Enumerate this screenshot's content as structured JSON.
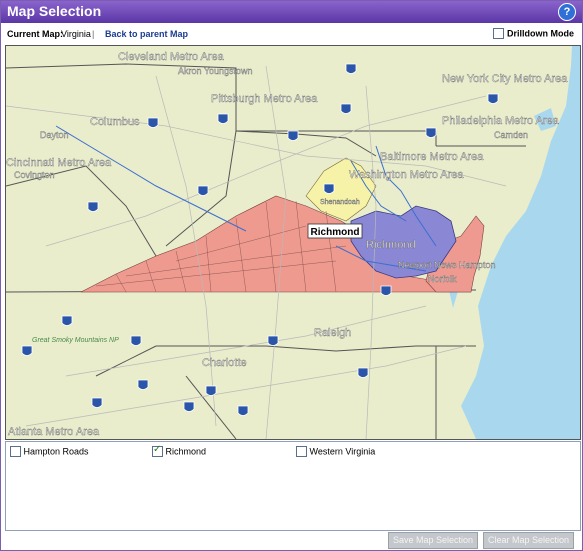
{
  "window": {
    "title": "Map Selection",
    "help_symbol": "?"
  },
  "toolbar": {
    "current_map_label": "Current Map:",
    "current_map_value": "Virginia",
    "separator": "|",
    "back_link": "Back to parent Map",
    "drilldown_label": "Drilldown Mode",
    "drilldown_checked": false
  },
  "map": {
    "selected_label": "Richmond",
    "place_labels": {
      "cleveland": "Cleveland Metro Area",
      "akron": "Akron Youngstown",
      "pittsburgh": "Pittsburgh Metro Area",
      "nyc": "New York City Metro Area",
      "philly": "Philadelphia Metro Area",
      "camden": "Camden",
      "columbus": "Columbus",
      "dayton": "Dayton",
      "cincinnati": "Cincinnati Metro Area",
      "covington": "Covington",
      "baltimore": "Baltimore Metro Area",
      "washington": "Washington Metro Area",
      "shenandoah": "Shenandoah",
      "richmond_overlay": "Richmond",
      "hampton": "Newport News Hampton",
      "norfolk": "Norfolk",
      "raleigh": "Raleigh",
      "smoky": "Great Smoky Mountains NP",
      "charlotte": "Charlotte",
      "atlanta": "Atlanta Metro Area"
    },
    "colors": {
      "water": "#a9d8ee",
      "land": "#e9edcc",
      "selected": "#8a87d4",
      "other_region": "#ef9a8f",
      "hampton_region": "#ee9a90"
    }
  },
  "regions": [
    {
      "label": "Hampton Roads",
      "checked": false
    },
    {
      "label": "Richmond",
      "checked": true
    },
    {
      "label": "Western Virginia",
      "checked": false
    }
  ],
  "buttons": {
    "save": "Save Map Selection",
    "clear": "Clear Map Selection"
  }
}
